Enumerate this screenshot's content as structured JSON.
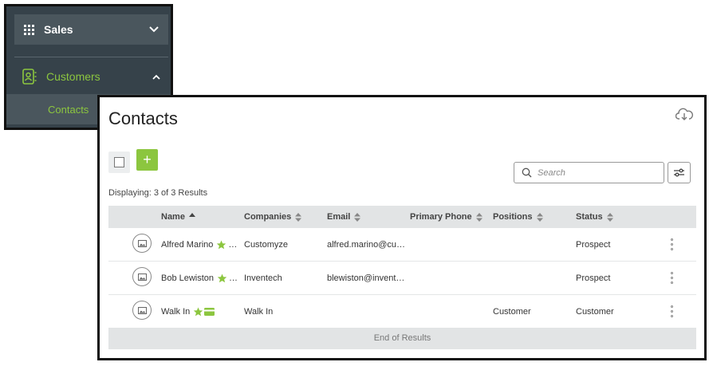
{
  "sidebar": {
    "sales_label": "Sales",
    "customers_label": "Customers",
    "contacts_label": "Contacts"
  },
  "contacts": {
    "title": "Contacts",
    "search_placeholder": "Search",
    "result_count": "Displaying: 3 of 3 Results",
    "columns": [
      "Name",
      "Companies",
      "Email",
      "Primary Phone",
      "Positions",
      "Status"
    ],
    "rows": [
      {
        "name": "Alfred Marino",
        "company": "Customyze",
        "email": "alfred.marino@cu…",
        "phone": "",
        "position": "",
        "status": "Prospect"
      },
      {
        "name": "Bob Lewiston",
        "company": "Inventech",
        "email": "blewiston@invent…",
        "phone": "",
        "position": "",
        "status": "Prospect"
      },
      {
        "name": "Walk In",
        "company": "Walk In",
        "email": "",
        "phone": "",
        "position": "Customer",
        "status": "Customer"
      }
    ],
    "end_text": "End of Results"
  },
  "colors": {
    "accent": "#8cc63f",
    "sidebar_bg": "#36424a",
    "header_bg": "#e2e4e5"
  },
  "icons": {
    "sales": "grid-icon",
    "customers": "contact-book-icon",
    "export": "cloud-download-icon",
    "search": "search-icon",
    "filter": "sliders-icon",
    "favorite": "star-icon",
    "card": "credit-card-icon",
    "row_menu": "kebab-icon"
  }
}
